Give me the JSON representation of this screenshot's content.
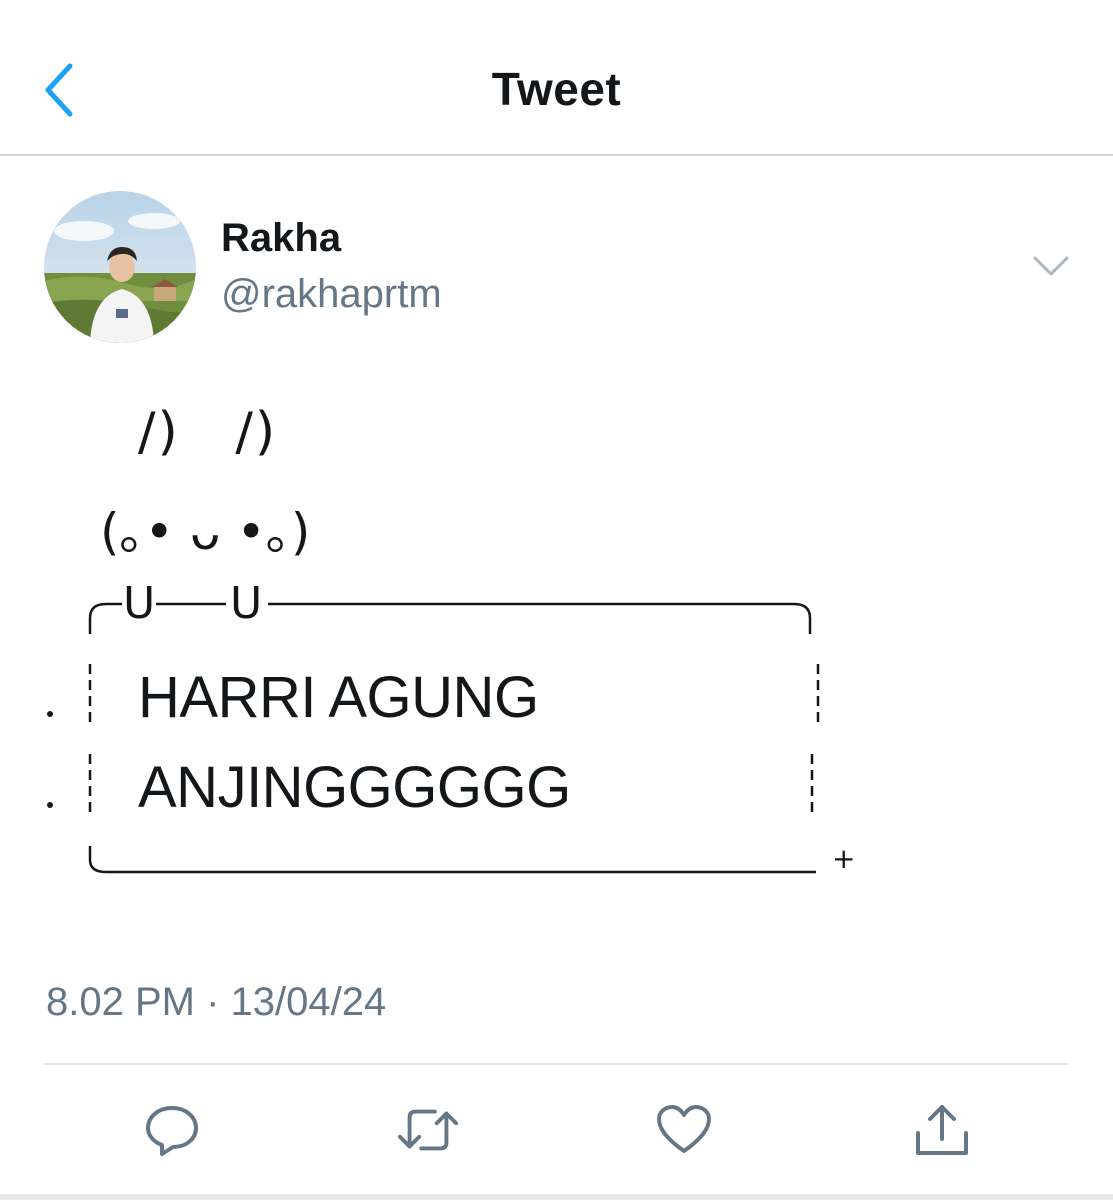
{
  "header": {
    "title": "Tweet",
    "back_icon": "chevron-left-icon",
    "accent_color": "#1da1f2"
  },
  "author": {
    "display_name": "Rakha",
    "handle": "@rakhaprtm",
    "more_icon": "chevron-down-icon"
  },
  "tweet": {
    "art": {
      "ears": "/)   /)",
      "face": "(｡• ᴗ •｡)",
      "u_marks": [
        "U",
        "U"
      ],
      "lines": [
        "HARRI AGUNG",
        "ANJINGGGGGG"
      ],
      "end_mark": "+"
    },
    "timestamp": "8.02 PM · 13/04/24"
  },
  "actions": [
    {
      "name": "reply",
      "icon": "reply-icon"
    },
    {
      "name": "retweet",
      "icon": "retweet-icon"
    },
    {
      "name": "like",
      "icon": "heart-icon"
    },
    {
      "name": "share",
      "icon": "share-icon"
    }
  ]
}
